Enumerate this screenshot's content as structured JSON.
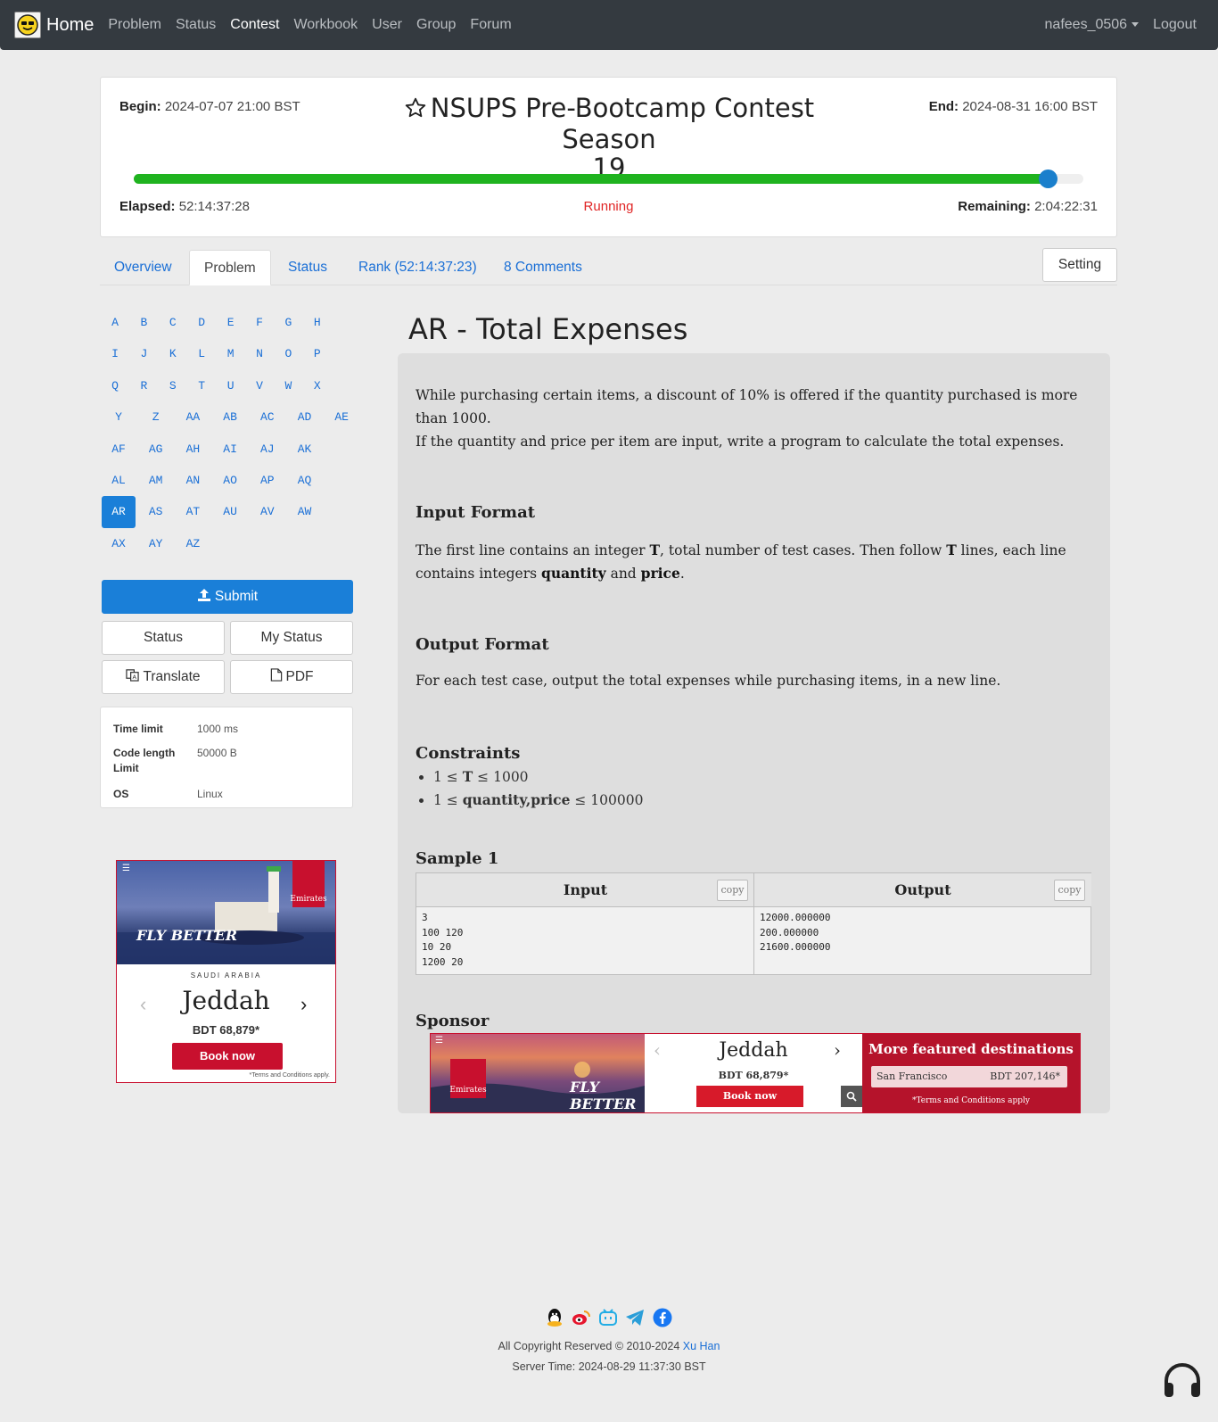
{
  "nav": {
    "brand": "Home",
    "links": [
      "Problem",
      "Status",
      "Contest",
      "Workbook",
      "User",
      "Group",
      "Forum"
    ],
    "user": "nafees_0506",
    "logout": "Logout"
  },
  "contest": {
    "begin_label": "Begin:",
    "begin": "2024-07-07 21:00 BST",
    "end_label": "End:",
    "end": "2024-08-31 16:00 BST",
    "title_line1": "NSUPS Pre-Bootcamp Contest Season",
    "title_line2": "19",
    "elapsed_label": "Elapsed:",
    "elapsed": "52:14:37:28",
    "remaining_label": "Remaining:",
    "remaining": "2:04:22:31",
    "state": "Running",
    "progress_fraction": 0.962,
    "progress_color": "#1fb31f",
    "knob_color": "#1a7fcc"
  },
  "tabs": {
    "items": [
      "Overview",
      "Problem",
      "Status",
      "Rank (52:14:37:23)",
      "8 Comments"
    ],
    "active": "Problem",
    "setting": "Setting"
  },
  "problem_letters": {
    "rows": [
      [
        "A",
        "B",
        "C",
        "D",
        "E",
        "F",
        "G",
        "H"
      ],
      [
        "I",
        "J",
        "K",
        "L",
        "M",
        "N",
        "O",
        "P"
      ],
      [
        "Q",
        "R",
        "S",
        "T",
        "U",
        "V",
        "W",
        "X"
      ],
      [
        "Y",
        "Z",
        "AA",
        "AB",
        "AC",
        "AD",
        "AE"
      ],
      [
        "AF",
        "AG",
        "AH",
        "AI",
        "AJ",
        "AK"
      ],
      [
        "AL",
        "AM",
        "AN",
        "AO",
        "AP",
        "AQ"
      ],
      [
        "AR",
        "AS",
        "AT",
        "AU",
        "AV",
        "AW"
      ],
      [
        "AX",
        "AY",
        "AZ"
      ]
    ],
    "active": "AR"
  },
  "actions": {
    "submit": "Submit",
    "status": "Status",
    "my_status": "My Status",
    "translate": "Translate",
    "pdf": "PDF"
  },
  "limits": {
    "time_label": "Time limit",
    "time": "1000 ms",
    "code_label_1": "Code length",
    "code_label_2": "Limit",
    "code": "50000 B",
    "os_label": "OS",
    "os": "Linux"
  },
  "problem": {
    "title": "AR - Total Expenses",
    "desc_1": "While purchasing certain items, a discount of 10% is offered if the quantity purchased is more than 1000.",
    "desc_2": "If the quantity and price per item are input, write a program to calculate the total expenses.",
    "input_head": "Input Format",
    "input_p1": "The first line contains an integer ",
    "input_t1": "T",
    "input_p2": ", total number of test cases. Then follow ",
    "input_t2": "T",
    "input_p3": " lines, each line contains integers ",
    "input_q": "quantity",
    "input_and": " and ",
    "input_price": "price",
    "input_end": ".",
    "output_head": "Output Format",
    "output_text": "For each test case, output the total expenses while purchasing items, in a new line.",
    "constraints_head": "Constraints",
    "c1_pre": "1 ≤ ",
    "c1_var": "T",
    "c1_post": " ≤ 1000",
    "c2_pre": "1 ≤ ",
    "c2_var": "quantity,price",
    "c2_post": " ≤ 100000",
    "sample_head": "Sample 1",
    "input_col": "Input",
    "output_col": "Output",
    "copy": "copy",
    "sample_input": "3\n100 120\n10 20\n1200 20",
    "sample_output": "12000.000000\n200.000000\n21600.000000",
    "sponsor_head": "Sponsor"
  },
  "ad_left": {
    "country": "SAUDI ARABIA",
    "city": "Jeddah",
    "price": "BDT 68,879*",
    "book": "Book now",
    "terms": "*Terms and Conditions apply.",
    "tagline": "FLY BETTER",
    "brand": "Emirates"
  },
  "ad_wide": {
    "city": "Jeddah",
    "price": "BDT 68,879*",
    "book": "Book now",
    "featured": "More featured destinations",
    "dest": "San Francisco",
    "dest_price": "BDT 207,146*",
    "terms": "*Terms and Conditions apply",
    "tagline": "FLY BETTER",
    "brand": "Emirates"
  },
  "footer": {
    "copyright": "All Copyright Reserved © 2010-2024 ",
    "author": "Xu Han",
    "server_time": "Server Time: 2024-08-29 11:37:30 BST"
  },
  "colors": {
    "primary": "#1a7fd8",
    "link": "#1a6fd6",
    "navbar": "#343a40",
    "running": "#e02424",
    "ad_red": "#c8102e"
  }
}
